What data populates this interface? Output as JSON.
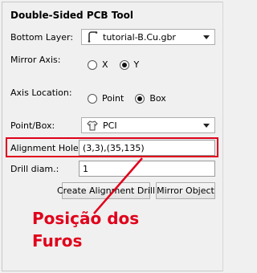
{
  "panel": {
    "title": "Double-Sided PCB Tool",
    "bottom_layer": {
      "label": "Bottom Layer:",
      "value": "tutorial-B.Cu.gbr",
      "icon": "layer-icon"
    },
    "mirror_axis": {
      "label": "Mirror Axis:",
      "options": [
        "X",
        "Y"
      ],
      "selected": "Y"
    },
    "axis_location": {
      "label": "Axis Location:",
      "options": [
        "Point",
        "Box"
      ],
      "selected": "Box"
    },
    "point_box": {
      "label": "Point/Box:",
      "value": "PCI",
      "icon": "object-icon"
    },
    "alignment_holes": {
      "label": "Alignment Holes:",
      "value": "(3,3),(35,135)"
    },
    "drill_diam": {
      "label": "Drill diam.:",
      "value": "1"
    },
    "buttons": {
      "create_alignment_drill": "Create Alignment Drill",
      "mirror_object": "Mirror Object"
    }
  },
  "annotation": {
    "line1": "Posição dos",
    "line2": "Furos",
    "color": "#e0001b"
  }
}
